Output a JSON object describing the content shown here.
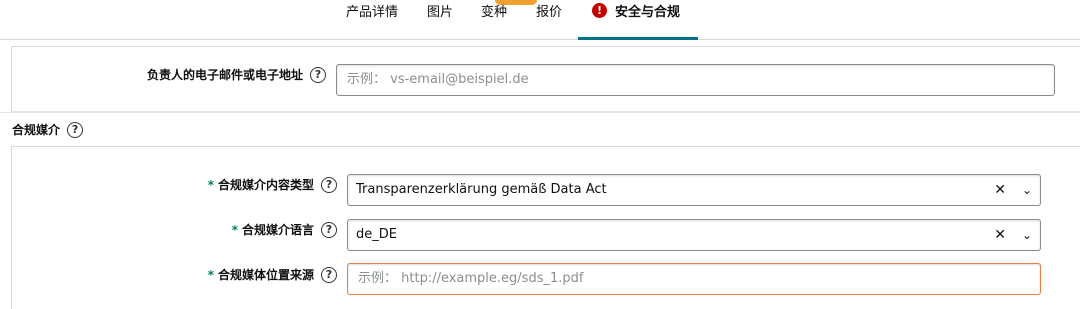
{
  "tabs": {
    "product_details": "产品详情",
    "images": "图片",
    "variations": "变种",
    "offer": "报价",
    "safety_compliance": "安全与合规"
  },
  "icons": {
    "alert": "!",
    "help": "?",
    "clear": "✕",
    "chevron": "⌄"
  },
  "responsible_contact": {
    "label": "负责人的电子邮件或电子地址",
    "placeholder": "示例： vs-email@beispiel.de"
  },
  "compliance_media": {
    "title": "合规媒介",
    "content_type": {
      "required_mark": "*",
      "label": "合规媒介内容类型",
      "value": "Transparenzerklärung gemäß Data Act"
    },
    "language": {
      "required_mark": "*",
      "label": "合规媒介语言",
      "value": "de_DE"
    },
    "source_location": {
      "required_mark": "*",
      "label": "合规媒体位置来源",
      "placeholder": "示例： http://example.eg/sds_1.pdf"
    }
  },
  "colors": {
    "accent": "#007185",
    "required": "#067d62",
    "alert": "#c40000",
    "error_border": "#e77e4a"
  }
}
